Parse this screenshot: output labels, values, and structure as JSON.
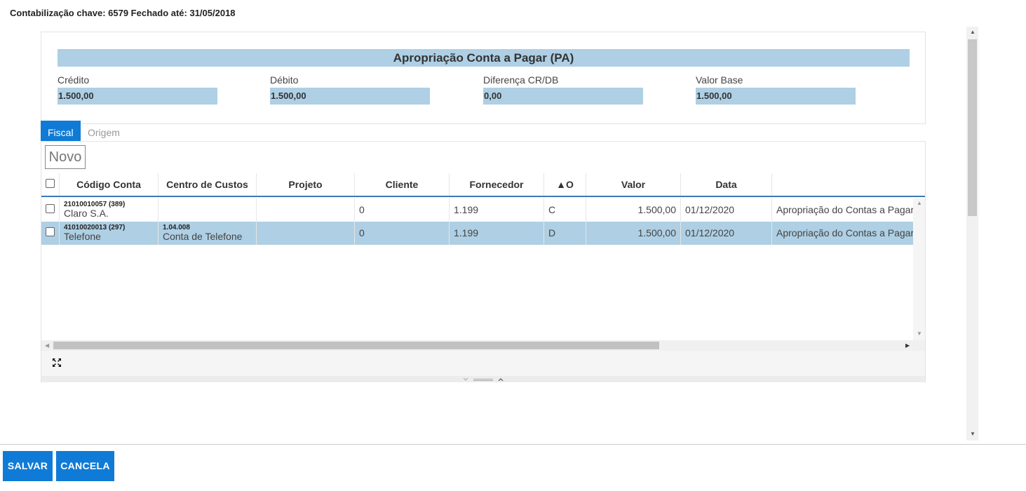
{
  "header": {
    "title": "Contabilização chave: 6579 Fechado até: 31/05/2018"
  },
  "summary": {
    "title": "Apropriação Conta a Pagar (PA)",
    "fields": [
      {
        "label": "Crédito",
        "value": "1.500,00"
      },
      {
        "label": "Débito",
        "value": "1.500,00"
      },
      {
        "label": "Diferença CR/DB",
        "value": "0,00"
      },
      {
        "label": "Valor Base",
        "value": "1.500,00"
      }
    ]
  },
  "tabs": [
    {
      "label": "Fiscal",
      "active": true
    },
    {
      "label": "Origem",
      "active": false
    }
  ],
  "toolbar": {
    "novo_label": "Novo"
  },
  "table": {
    "columns": [
      "Código Conta",
      "Centro de Custos",
      "Projeto",
      "Cliente",
      "Fornecedor",
      "▲O",
      "Valor",
      "Data",
      ""
    ],
    "rows": [
      {
        "codigo": "21010010057 (389)",
        "conta_nome": "Claro S.A.",
        "centro_codigo": "",
        "centro_nome": "",
        "projeto": "",
        "cliente": "0",
        "fornecedor": "1.199",
        "o": "C",
        "valor": "1.500,00",
        "data": "01/12/2020",
        "historico": "Apropriação do Contas a Pagar",
        "selected": false
      },
      {
        "codigo": "41010020013 (297)",
        "conta_nome": "Telefone",
        "centro_codigo": "1.04.008",
        "centro_nome": "Conta de Telefone",
        "projeto": "",
        "cliente": "0",
        "fornecedor": "1.199",
        "o": "D",
        "valor": "1.500,00",
        "data": "01/12/2020",
        "historico": "Apropriação do Contas a Pagar",
        "selected": true
      }
    ]
  },
  "icons": {
    "expand": "expand-icon",
    "resize_down": "chevron-down-icon",
    "resize_up": "chevron-up-icon"
  },
  "actions": {
    "save_label": "SALVAR",
    "cancel_label": "CANCELA"
  },
  "colors": {
    "accent": "#0f7bd6",
    "highlight": "#aecfe4",
    "header_border": "#3d7ab7"
  }
}
